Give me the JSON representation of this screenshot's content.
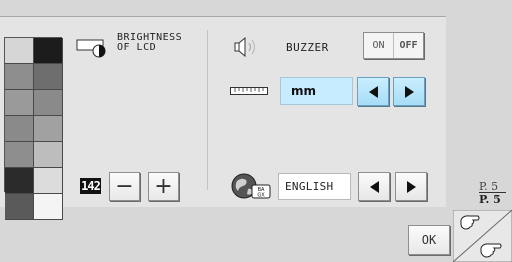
{
  "brightness": {
    "label_line1": "BRIGHTNESS",
    "label_line2": "OF LCD",
    "level": "142",
    "minus_label": "−",
    "plus_label": "+",
    "swatches": [
      "#d6d6d6",
      "#1c1c1c",
      "#8d8d8d",
      "#6e6e6e",
      "#9a9a9a",
      "#8a8a8a",
      "#8a8a8a",
      "#a1a1a1",
      "#8e8e8e",
      "#bdbdbd",
      "#2b2b2b",
      "#dcdcdc",
      "#5a5a5a",
      "#f4f4f4"
    ]
  },
  "buzzer": {
    "label": "BUZZER",
    "on_label": "ON",
    "off_label": "OFF",
    "state": "OFF"
  },
  "units": {
    "value": "mm"
  },
  "language": {
    "value": "ENGLISH"
  },
  "page": {
    "current": "P. 5",
    "total": "P. 5"
  },
  "ok_label": "OK",
  "colors": {
    "accent": "#c7ecff",
    "arrow_blue": "#b6e4fb",
    "panel": "#e4e4e4",
    "background": "#d7d7d7"
  }
}
